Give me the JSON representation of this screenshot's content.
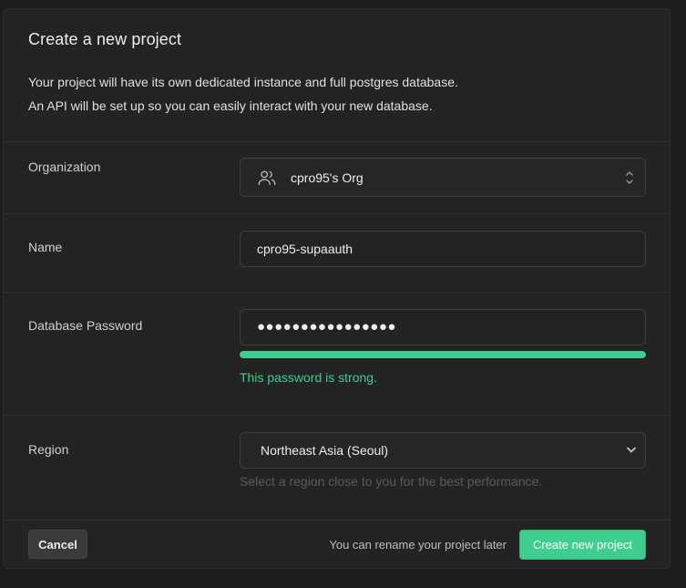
{
  "dialog": {
    "title": "Create a new project",
    "description_line1": "Your project will have its own dedicated instance and full postgres database.",
    "description_line2": "An API will be set up so you can easily interact with your new database."
  },
  "organization": {
    "label": "Organization",
    "selected": "cpro95's Org",
    "icon": "users-icon"
  },
  "name": {
    "label": "Name",
    "value": "cpro95-supaauth"
  },
  "password": {
    "label": "Database Password",
    "masked_value": "●●●●●●●●●●●●●●●●",
    "strength_fraction": 1.0,
    "strength_text": "This password is strong.",
    "strength_color": "#3ecf8e"
  },
  "region": {
    "label": "Region",
    "selected": "Northeast Asia (Seoul)",
    "hint": "Select a region close to you for the best performance."
  },
  "footer": {
    "cancel_label": "Cancel",
    "note": "You can rename your project later",
    "create_label": "Create new project"
  },
  "colors": {
    "accent": "#3ecf8e",
    "background": "#1c1c1c",
    "panel": "#232323"
  }
}
